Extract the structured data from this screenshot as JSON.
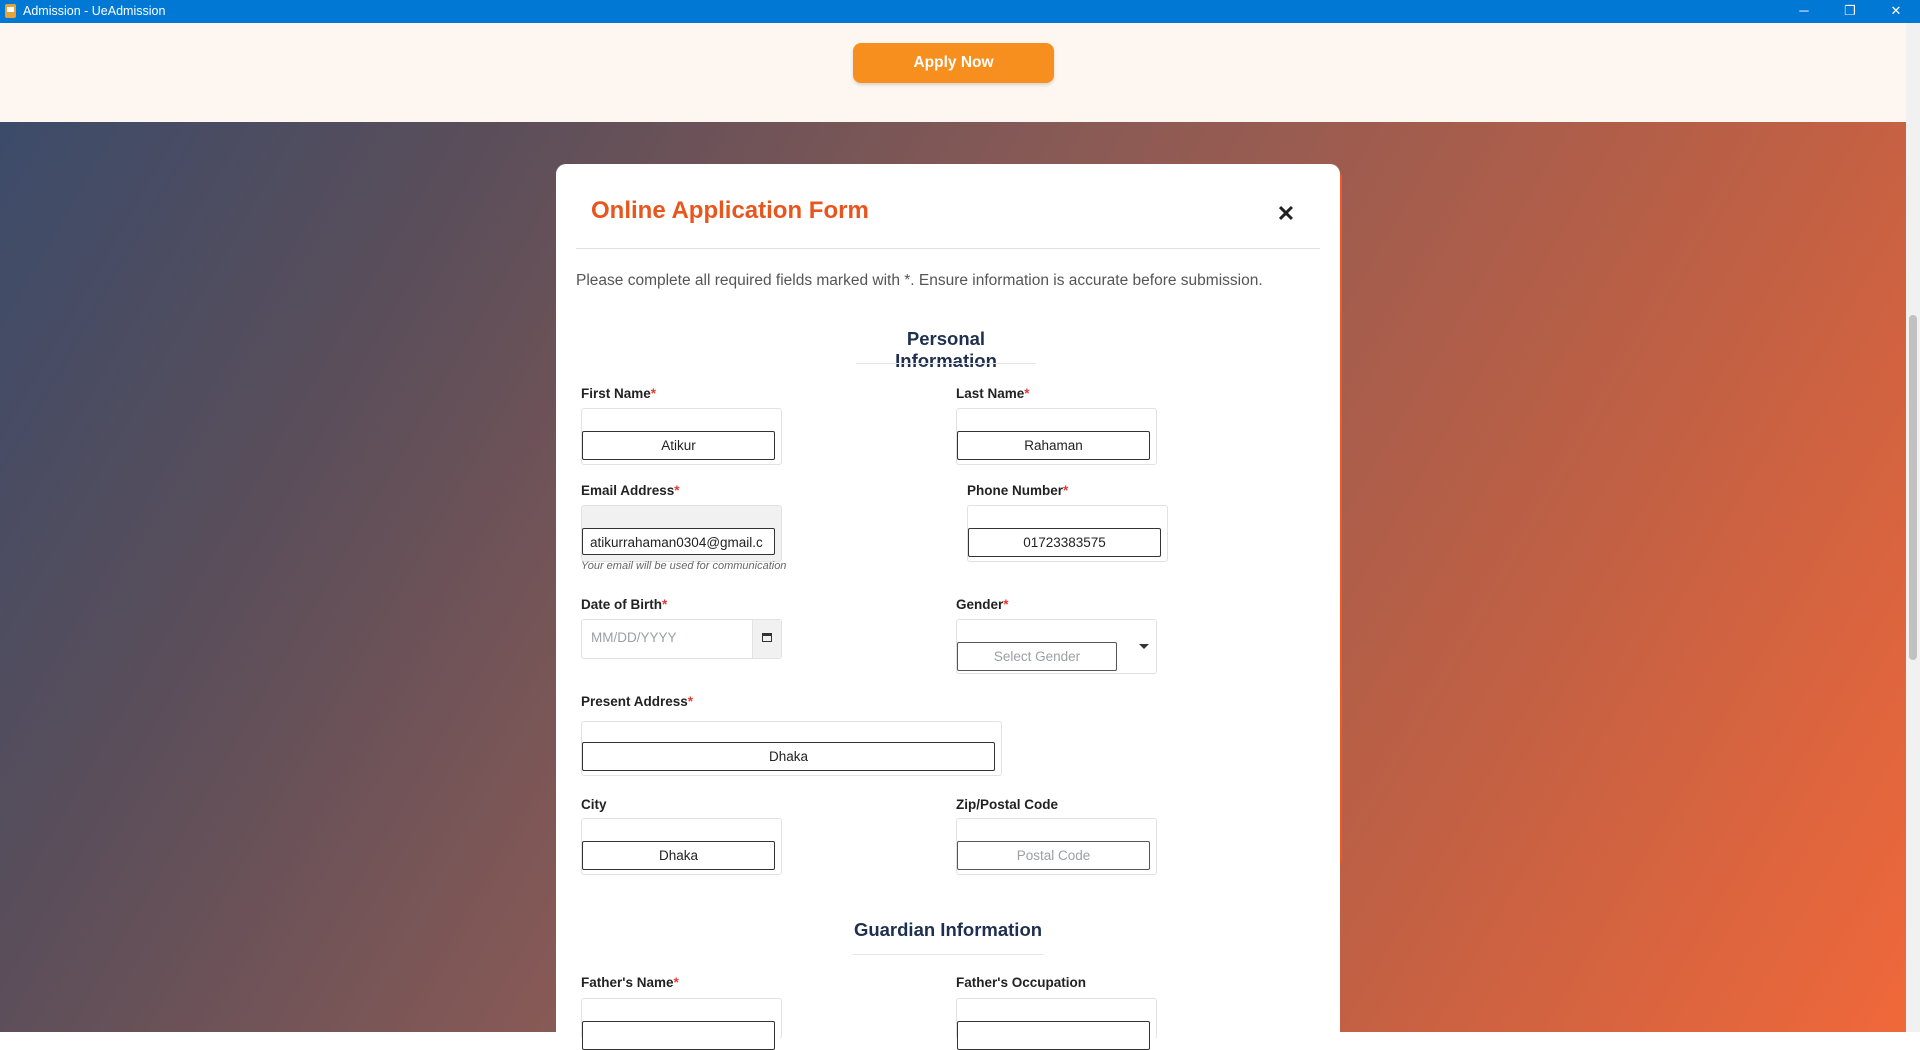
{
  "window": {
    "title": "Admission - UeAdmission",
    "minimize": "─",
    "restore": "❐",
    "close": "✕"
  },
  "header": {
    "apply_label": "Apply Now"
  },
  "modal": {
    "title": "Online Application Form",
    "close_glyph": "✕",
    "instructions": "Please complete all required fields marked with *. Ensure information is accurate before submission.",
    "personal_section": "Personal Information",
    "guardian_section": "Guardian Information",
    "required_mark": "*",
    "fields": {
      "first_name": {
        "label": "First Name",
        "value": "Atikur"
      },
      "last_name": {
        "label": "Last Name",
        "value": "Rahaman"
      },
      "email": {
        "label": "Email Address",
        "value": "atikurrahaman0304@gmail.c",
        "hint": "Your email will be used for communication"
      },
      "phone": {
        "label": "Phone Number",
        "value": "01723383575"
      },
      "dob": {
        "label": "Date of Birth",
        "placeholder": "MM/DD/YYYY"
      },
      "gender": {
        "label": "Gender",
        "placeholder": "Select Gender"
      },
      "present_address": {
        "label": "Present Address",
        "value": "Dhaka"
      },
      "city": {
        "label": "City",
        "value": "Dhaka"
      },
      "zip": {
        "label": "Zip/Postal Code",
        "placeholder": "Postal Code"
      },
      "father_name": {
        "label": "Father's Name"
      },
      "father_occupation": {
        "label": "Father's Occupation"
      }
    }
  },
  "colors": {
    "titlebar": "#0078d4",
    "accent": "#e8561d",
    "apply_button": "#f78f1e",
    "section_title": "#1e2f4f",
    "required": "#e53935"
  }
}
